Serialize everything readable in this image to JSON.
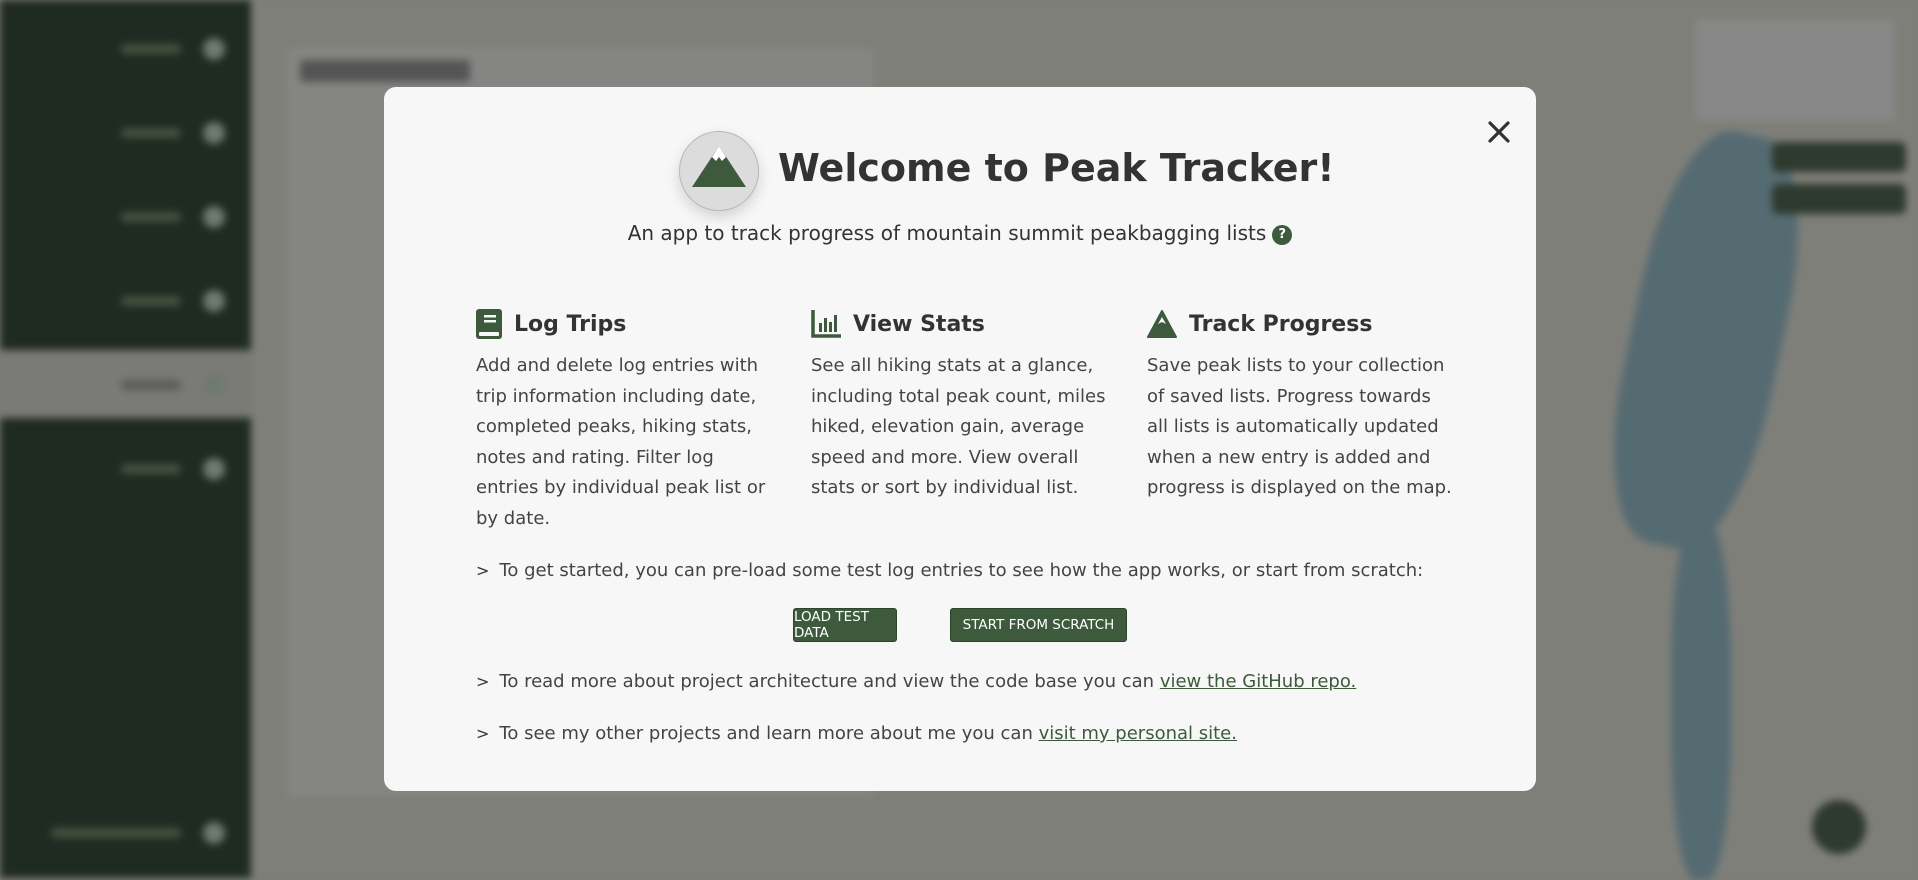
{
  "modal": {
    "title": "Welcome to Peak Tracker!",
    "subtitle": "An app to track progress of mountain summit peakbagging lists",
    "help_icon": "?",
    "close_icon": "close-icon",
    "features": [
      {
        "icon": "book-icon",
        "title": "Log Trips",
        "text": "Add and delete log entries with trip information including date, completed peaks, hiking stats, notes and rating. Filter log entries by individual peak list or by date."
      },
      {
        "icon": "chart-bar-icon",
        "title": "View Stats",
        "text": "See all hiking stats at a glance, including total peak count, miles hiked, elevation gain, average speed and more. View overall stats or sort by individual list."
      },
      {
        "icon": "mountain-icon",
        "title": "Track Progress",
        "text": "Save peak lists to your collection of saved lists. Progress towards all lists is automatically updated when a new entry is added and progress is displayed on the map."
      }
    ],
    "get_started_text": "To get started, you can pre-load some test log entries to see how the app works, or start from scratch:",
    "load_test_data_label": "LOAD TEST DATA",
    "start_from_scratch_label": "START FROM SCRATCH",
    "github_text": "To read more about project architecture and view the code base you can ",
    "github_link": "view the GitHub repo.",
    "site_text": "To see my other projects and learn more about me you can ",
    "site_link": "visit my personal site."
  },
  "colors": {
    "accent": "#3d5a3d",
    "sidebar": "#1f2a20",
    "modal_bg": "#f7f7f7"
  }
}
